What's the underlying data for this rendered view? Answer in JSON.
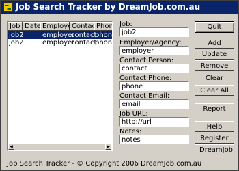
{
  "window": {
    "title": "Job Search Tracker by DreamJob.com.au"
  },
  "list": {
    "columns": [
      "Job",
      "Date",
      "Employer",
      "Contact",
      "Phone"
    ],
    "rows": [
      {
        "job": "job2",
        "date": "",
        "employer": "employer",
        "contact": "contact",
        "phone": "phone",
        "selected": true
      },
      {
        "job": "job2",
        "date": "",
        "employer": "employer",
        "contact": "contact",
        "phone": "phone",
        "selected": false
      }
    ]
  },
  "form": {
    "job_label": "Job:",
    "job_value": "job2",
    "employer_label": "Employer/Agency:",
    "employer_value": "employer",
    "contact_label": "Contact Person:",
    "contact_value": "contact",
    "phone_label": "Contact Phone:",
    "phone_value": "phone",
    "email_label": "Contact Email:",
    "email_value": "email",
    "url_label": "Job URL:",
    "url_value": "http://url",
    "notes_label": "Notes:",
    "notes_value": "notes"
  },
  "buttons": {
    "quit": "Quit",
    "add": "Add",
    "update": "Update",
    "remove": "Remove",
    "clear": "Clear",
    "clear_all": "Clear All",
    "report": "Report",
    "help": "Help",
    "register": "Register",
    "dreamjob": "DreamJob"
  },
  "status": {
    "text": "Job Search Tracker - © Copyright 2006 DreamJob.com.au"
  },
  "colors": {
    "title_bar": "#0a246a",
    "face": "#d4d0c8",
    "selection": "#0a246a"
  }
}
